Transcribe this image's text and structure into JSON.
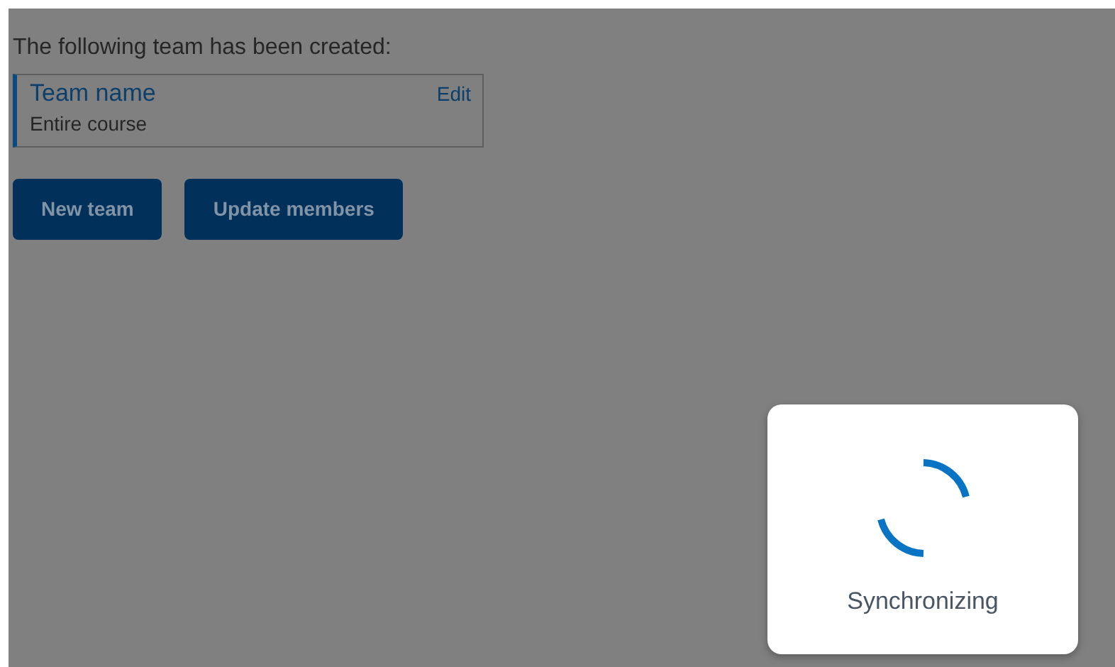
{
  "message": "The following team has been created:",
  "team": {
    "name": "Team name",
    "edit": "Edit",
    "scope": "Entire course"
  },
  "buttons": [
    "New team",
    "Update members"
  ],
  "dialog": {
    "status": "Synchronizing"
  }
}
